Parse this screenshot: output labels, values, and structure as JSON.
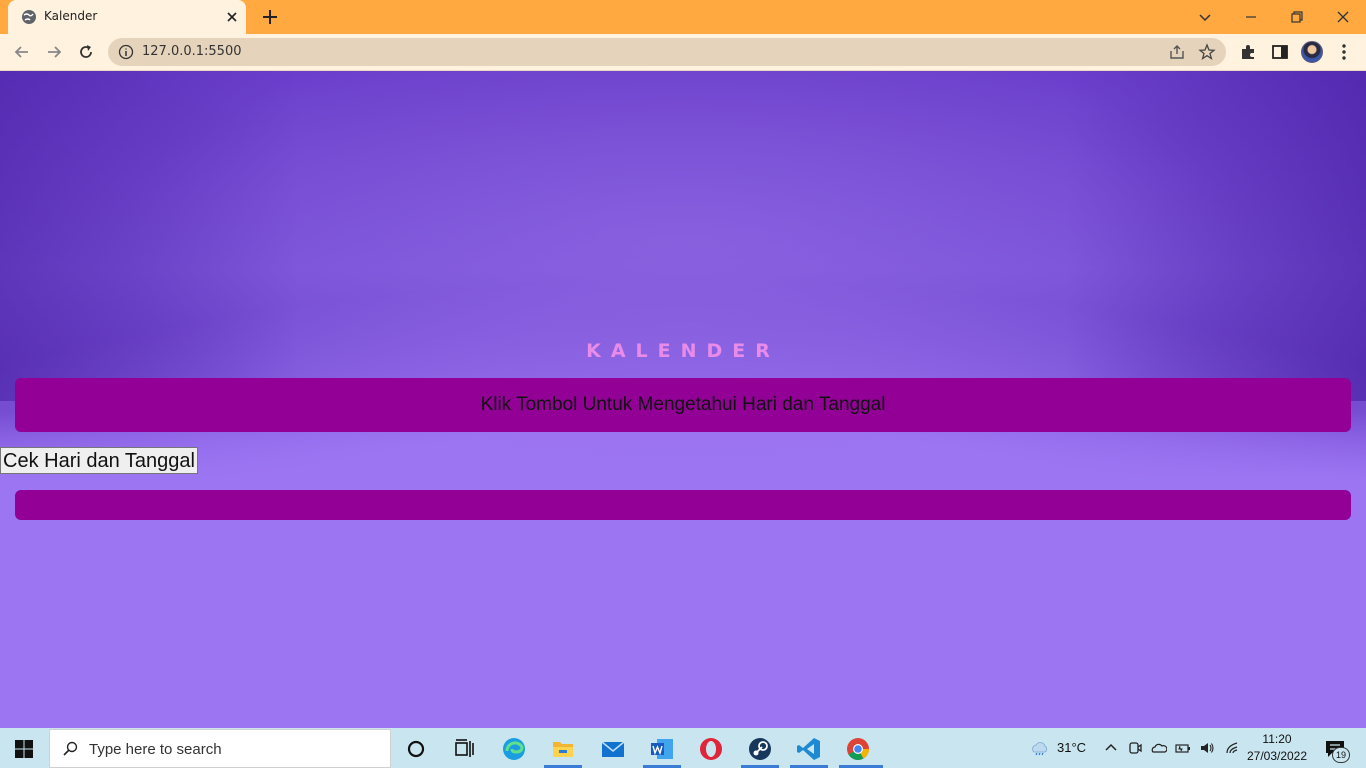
{
  "browser": {
    "tab_title": "Kalender",
    "url": "127.0.0.1:5500",
    "accent_color": "#FFA940"
  },
  "page": {
    "heading": "KALENDER",
    "banner_text": "Klik Tombol Untuk Mengetahui Hari dan Tanggal",
    "button_label": "Cek Hari dan Tanggal",
    "result_text": "",
    "colors": {
      "bar": "#920096",
      "heading": "#E98BE8",
      "background": "#9C75F3"
    }
  },
  "taskbar": {
    "search_placeholder": "Type here to search",
    "weather_temp": "31°C",
    "time": "11:20",
    "date": "27/03/2022",
    "notification_count": "19",
    "pinned_icons": [
      "cortana-icon",
      "task-view-icon",
      "edge-icon",
      "file-explorer-icon",
      "mail-icon",
      "word-icon",
      "opera-icon",
      "steam-icon",
      "vscode-icon",
      "chrome-icon"
    ]
  }
}
